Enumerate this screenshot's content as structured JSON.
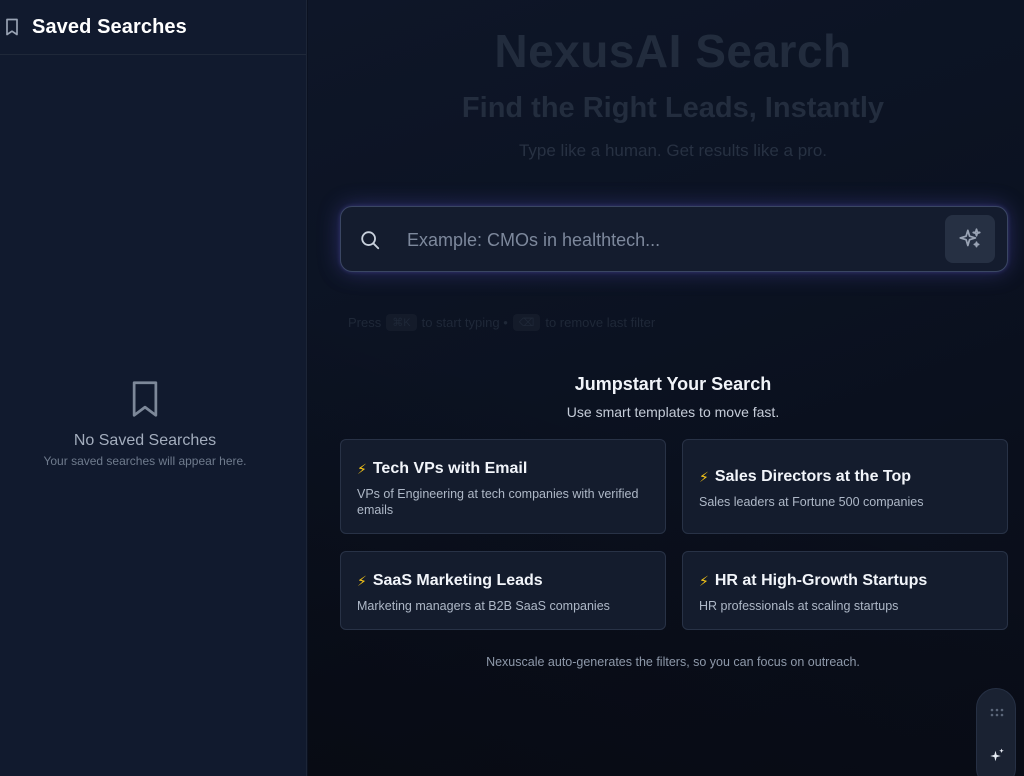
{
  "sidebar": {
    "title": "Saved Searches",
    "empty_title": "No Saved Searches",
    "empty_subtitle": "Your saved searches will appear here."
  },
  "hero": {
    "title": "NexusAI Search",
    "subtitle": "Find the Right Leads, Instantly",
    "tagline": "Type like a human. Get results like a pro."
  },
  "search": {
    "placeholder": "Example: CMOs in healthtech..."
  },
  "hint": {
    "press": "Press",
    "key1": "⌘K",
    "mid": "to start typing •",
    "key2": "⌫",
    "end": "to remove last filter"
  },
  "templates": {
    "title": "Jumpstart Your Search",
    "subtitle": "Use smart templates to move fast.",
    "cards": [
      {
        "title": "Tech VPs with Email",
        "description": "VPs of Engineering at tech companies with verified emails"
      },
      {
        "title": "Sales Directors at the Top",
        "description": "Sales leaders at Fortune 500 companies"
      },
      {
        "title": "SaaS Marketing Leads",
        "description": "Marketing managers at B2B SaaS companies"
      },
      {
        "title": "HR at High-Growth Startups",
        "description": "HR professionals at scaling startups"
      }
    ],
    "bolt_icon": "⚡"
  },
  "footer": {
    "note": "Nexuscale auto-generates the filters, so you can focus on outreach."
  },
  "colors": {
    "accent_glow": "#635bdc",
    "bolt": "#f5c518"
  }
}
